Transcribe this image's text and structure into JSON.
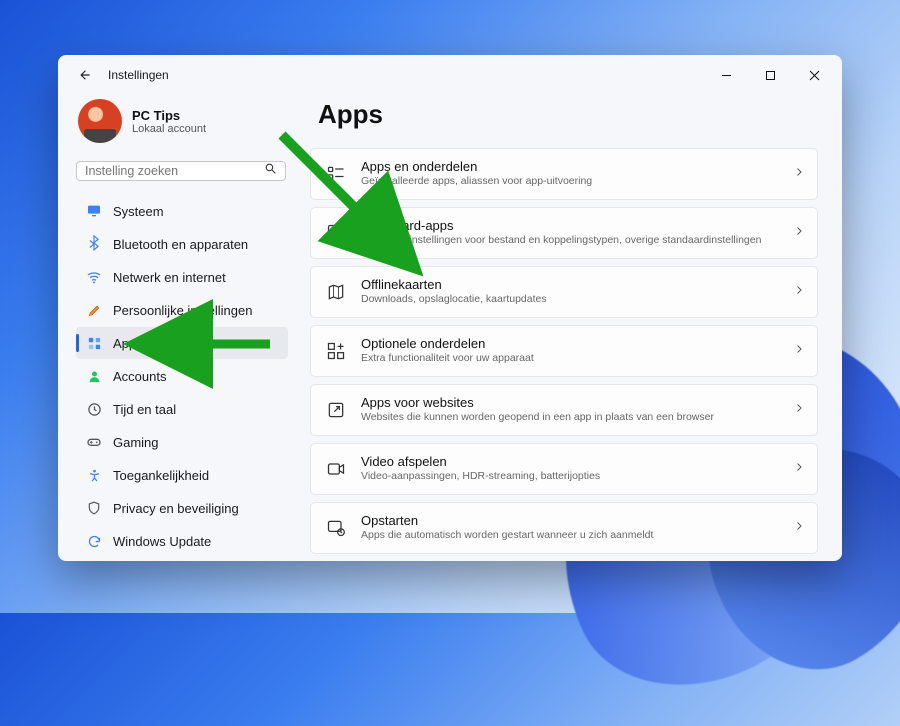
{
  "window": {
    "title": "Instellingen"
  },
  "profile": {
    "name": "PC Tips",
    "sub": "Lokaal account"
  },
  "search": {
    "placeholder": "Instelling zoeken"
  },
  "sidebar": {
    "items": [
      {
        "label": "Systeem"
      },
      {
        "label": "Bluetooth en apparaten"
      },
      {
        "label": "Netwerk en internet"
      },
      {
        "label": "Persoonlijke instellingen"
      },
      {
        "label": "Apps"
      },
      {
        "label": "Accounts"
      },
      {
        "label": "Tijd en taal"
      },
      {
        "label": "Gaming"
      },
      {
        "label": "Toegankelijkheid"
      },
      {
        "label": "Privacy en beveiliging"
      },
      {
        "label": "Windows Update"
      }
    ]
  },
  "main": {
    "heading": "Apps",
    "cards": [
      {
        "title": "Apps en onderdelen",
        "sub": "Geïnstalleerde apps, aliassen voor app-uitvoering"
      },
      {
        "title": "Standaard-apps",
        "sub": "Standaardinstellingen voor bestand en koppelingstypen, overige standaardinstellingen"
      },
      {
        "title": "Offlinekaarten",
        "sub": "Downloads, opslaglocatie, kaartupdates"
      },
      {
        "title": "Optionele onderdelen",
        "sub": "Extra functionaliteit voor uw apparaat"
      },
      {
        "title": "Apps voor websites",
        "sub": "Websites die kunnen worden geopend in een app in plaats van een browser"
      },
      {
        "title": "Video afspelen",
        "sub": "Video-aanpassingen, HDR-streaming, batterijopties"
      },
      {
        "title": "Opstarten",
        "sub": "Apps die automatisch worden gestart wanneer u zich aanmeldt"
      }
    ]
  }
}
